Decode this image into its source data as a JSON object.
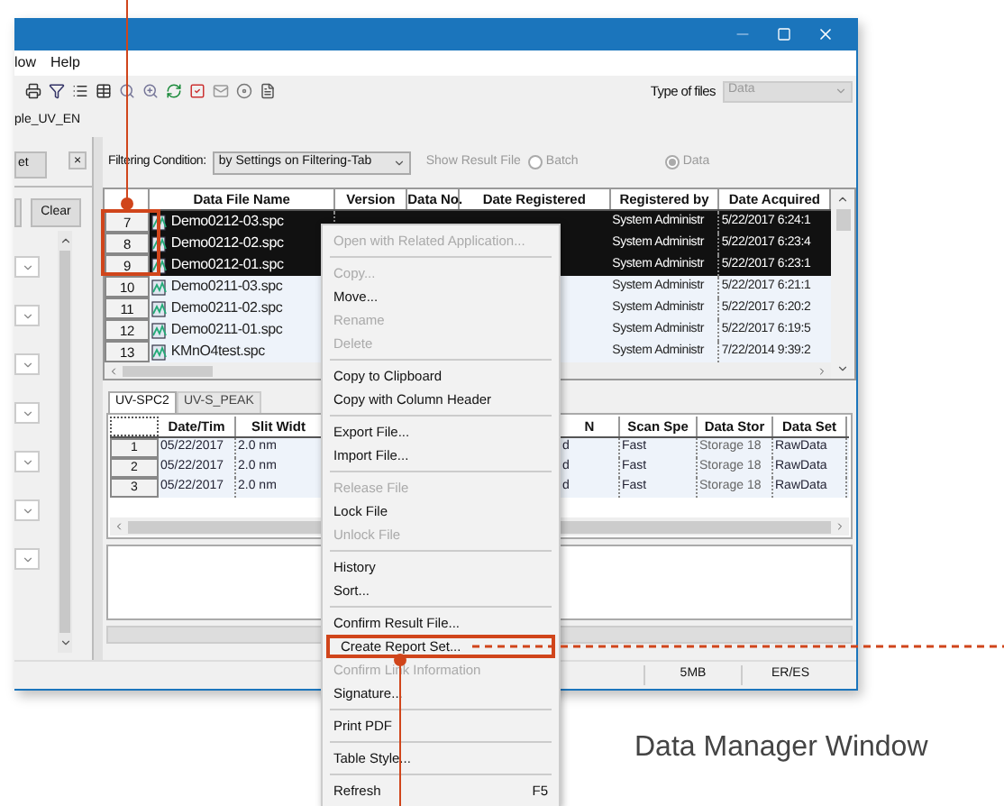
{
  "menu_bar": [
    "low",
    "Help"
  ],
  "toolbar": {
    "type_label": "Type of files",
    "type_value": "Data"
  },
  "path": "ple_UV_EN",
  "left_panel": {
    "top_button": "et",
    "close_button": "×",
    "clear_button": "Clear"
  },
  "filter": {
    "label": "Filtering Condition:",
    "value": "by Settings on Filtering-Tab",
    "show_result_label": "Show Result File",
    "radios": [
      {
        "label": "Batch",
        "selected": false
      },
      {
        "label": "Data",
        "selected": true
      }
    ]
  },
  "file_table": {
    "columns": [
      "Data File Name",
      "Version",
      "Data No.",
      "Date Registered",
      "Registered by",
      "Date Acquired"
    ],
    "rows": [
      {
        "number": "7",
        "name": "Demo0212-03.spc",
        "registered_by": "System Administr",
        "date_acquired": "5/22/2017 6:24:1",
        "selected": true
      },
      {
        "number": "8",
        "name": "Demo0212-02.spc",
        "registered_by": "System Administr",
        "date_acquired": "5/22/2017 6:23:4",
        "selected": true
      },
      {
        "number": "9",
        "name": "Demo0212-01.spc",
        "registered_by": "System Administr",
        "date_acquired": "5/22/2017 6:23:1",
        "selected": true
      },
      {
        "number": "10",
        "name": "Demo0211-03.spc",
        "registered_by": "System Administr",
        "date_acquired": "5/22/2017 6:21:1",
        "selected": false
      },
      {
        "number": "11",
        "name": "Demo0211-02.spc",
        "registered_by": "System Administr",
        "date_acquired": "5/22/2017 6:20:2",
        "selected": false
      },
      {
        "number": "12",
        "name": "Demo0211-01.spc",
        "registered_by": "System Administr",
        "date_acquired": "5/22/2017 6:19:5",
        "selected": false
      },
      {
        "number": "13",
        "name": "KMnO4test.spc",
        "registered_by": "System Administr",
        "date_acquired": "7/22/2014 9:39:2",
        "selected": false
      }
    ]
  },
  "tabs": [
    {
      "label": "UV-SPC2",
      "selected": true
    },
    {
      "label": "UV-S_PEAK",
      "selected": false
    }
  ],
  "result_table": {
    "columns": [
      "Date/Tim",
      "Slit Widt",
      "N",
      "Scan Spe",
      "Data Stor",
      "Data Set"
    ],
    "rows": [
      {
        "number": "1",
        "cells": [
          "05/22/2017",
          "2.0 nm",
          "d",
          "Fast",
          "Storage 18",
          "RawData"
        ]
      },
      {
        "number": "2",
        "cells": [
          "05/22/2017",
          "2.0 nm",
          "d",
          "Fast",
          "Storage 18",
          "RawData"
        ]
      },
      {
        "number": "3",
        "cells": [
          "05/22/2017",
          "2.0 nm",
          "d",
          "Fast",
          "Storage 18",
          "RawData"
        ]
      }
    ]
  },
  "status_bar": [
    "5MB",
    "ER/ES"
  ],
  "context_menu": [
    {
      "kind": "item",
      "label": "Open with Related Application...",
      "disabled": true
    },
    {
      "kind": "separator"
    },
    {
      "kind": "item",
      "label": "Copy...",
      "disabled": true
    },
    {
      "kind": "item",
      "label": "Move...",
      "disabled": false
    },
    {
      "kind": "item",
      "label": "Rename",
      "disabled": true
    },
    {
      "kind": "item",
      "label": "Delete",
      "disabled": true
    },
    {
      "kind": "separator"
    },
    {
      "kind": "item",
      "label": "Copy to Clipboard",
      "disabled": false
    },
    {
      "kind": "item",
      "label": "Copy with Column Header",
      "disabled": false
    },
    {
      "kind": "separator"
    },
    {
      "kind": "item",
      "label": "Export File...",
      "disabled": false
    },
    {
      "kind": "item",
      "label": "Import File...",
      "disabled": false
    },
    {
      "kind": "separator"
    },
    {
      "kind": "item",
      "label": "Release File",
      "disabled": true
    },
    {
      "kind": "item",
      "label": "Lock File",
      "disabled": false
    },
    {
      "kind": "item",
      "label": "Unlock File",
      "disabled": true
    },
    {
      "kind": "separator"
    },
    {
      "kind": "item",
      "label": "History",
      "disabled": false
    },
    {
      "kind": "item",
      "label": "Sort...",
      "disabled": false
    },
    {
      "kind": "separator"
    },
    {
      "kind": "item",
      "label": "Confirm Result File...",
      "disabled": false
    },
    {
      "kind": "item",
      "label": "Create Report Set...",
      "disabled": false,
      "callout": true
    },
    {
      "kind": "item",
      "label": "Confirm Link Information",
      "disabled": true
    },
    {
      "kind": "item",
      "label": "Signature...",
      "disabled": false
    },
    {
      "kind": "separator"
    },
    {
      "kind": "item",
      "label": "Print PDF",
      "disabled": false
    },
    {
      "kind": "separator"
    },
    {
      "kind": "item",
      "label": "Table Style...",
      "disabled": false
    },
    {
      "kind": "separator"
    },
    {
      "kind": "item",
      "label": "Refresh",
      "disabled": false,
      "shortcut": "F5"
    }
  ],
  "caption": "Data Manager Window"
}
